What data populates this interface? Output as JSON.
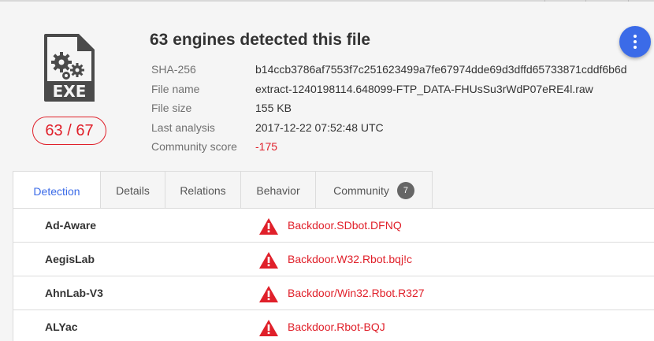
{
  "file": {
    "type_label": "EXE",
    "score": "63 / 67",
    "headline": "63 engines detected this file"
  },
  "meta": [
    {
      "key": "SHA-256",
      "value": "b14ccb3786af7553f7c251623499a7fe67974dde69d3dffd65733871cddf6b6d"
    },
    {
      "key": "File name",
      "value": "extract-1240198114.648099-FTP_DATA-FHUsSu3rWdP07eRE4l.raw"
    },
    {
      "key": "File size",
      "value": "155 KB"
    },
    {
      "key": "Last analysis",
      "value": "2017-12-22 07:52:48 UTC"
    },
    {
      "key": "Community score",
      "value": "-175"
    }
  ],
  "tabs": [
    {
      "label": "Detection",
      "active": true
    },
    {
      "label": "Details"
    },
    {
      "label": "Relations"
    },
    {
      "label": "Behavior"
    },
    {
      "label": "Community",
      "count": "7"
    }
  ],
  "detections": [
    {
      "engine": "Ad-Aware",
      "result": "Backdoor.SDbot.DFNQ"
    },
    {
      "engine": "AegisLab",
      "result": "Backdoor.W32.Rbot.bqj!c"
    },
    {
      "engine": "AhnLab-V3",
      "result": "Backdoor/Win32.Rbot.R327"
    },
    {
      "engine": "ALYac",
      "result": "Backdoor.Rbot-BQJ"
    }
  ],
  "colors": {
    "accent": "#3b6be8",
    "danger": "#e0202a"
  }
}
